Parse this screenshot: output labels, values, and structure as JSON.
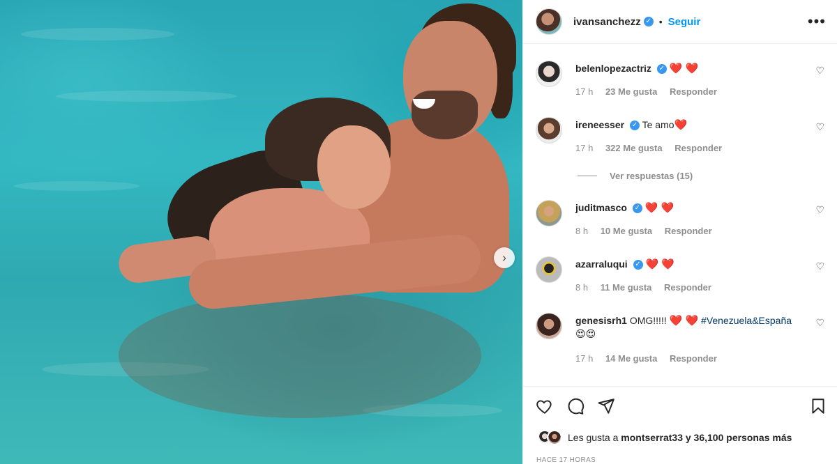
{
  "post": {
    "owner": "ivansanchezz",
    "follow_label": "Seguir",
    "dot": "•",
    "more_label": "•••"
  },
  "comments": [
    {
      "user": "belenlopezactriz",
      "verified": true,
      "text": "",
      "emoji": "❤️ ❤️",
      "time": "17 h",
      "likes": "23 Me gusta",
      "reply": "Responder"
    },
    {
      "user": "ireneesser",
      "verified": true,
      "text": "Te amo",
      "emoji": "❤️",
      "time": "17 h",
      "likes": "322 Me gusta",
      "reply": "Responder"
    },
    {
      "user": "juditmasco",
      "verified": true,
      "text": "",
      "emoji": "❤️ ❤️",
      "time": "8 h",
      "likes": "10 Me gusta",
      "reply": "Responder"
    },
    {
      "user": "azarraluqui",
      "verified": true,
      "text": "",
      "emoji": "❤️ ❤️",
      "time": "8 h",
      "likes": "11 Me gusta",
      "reply": "Responder"
    },
    {
      "user": "genesisrh1",
      "verified": false,
      "text": "OMG!!!!!",
      "emoji": "❤️ ❤️",
      "hashtag": "#Venezuela&España",
      "emoji2": "😍😍",
      "time": "17 h",
      "likes": "14 Me gusta",
      "reply": "Responder"
    }
  ],
  "view_replies": "Ver respuestas (15)",
  "liked_by": {
    "prefix": "Les gusta a",
    "user": "montserrat33",
    "suffix": "y 36,100 personas más"
  },
  "timestamp": "HACE 17 HORAS",
  "icons": {
    "verified": "✓",
    "next": "›",
    "heart_outline": "♡"
  }
}
